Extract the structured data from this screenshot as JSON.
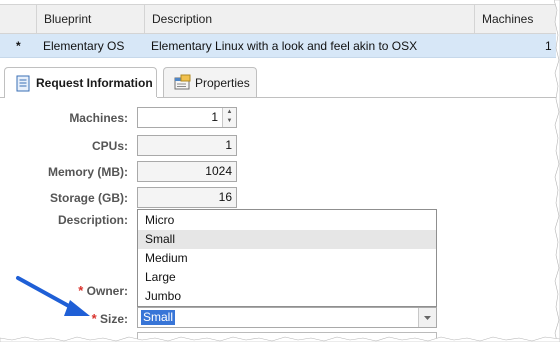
{
  "table": {
    "columns": [
      "Blueprint",
      "Description",
      "Machines"
    ],
    "row": {
      "required_marker": "*",
      "blueprint": "Elementary OS",
      "description": "Elementary Linux with a look and feel akin to OSX",
      "machines": "1"
    }
  },
  "tabs": [
    {
      "label": "Request Information",
      "icon": "document-icon",
      "active": true
    },
    {
      "label": "Properties",
      "icon": "properties-icon",
      "active": false
    }
  ],
  "form": {
    "machines": {
      "label": "Machines:",
      "value": "1"
    },
    "cpus": {
      "label": "CPUs:",
      "value": "1"
    },
    "memory": {
      "label": "Memory (MB):",
      "value": "1024"
    },
    "storage": {
      "label": "Storage (GB):",
      "value": "16"
    },
    "description": {
      "label": "Description:"
    },
    "owner": {
      "label": "Owner:",
      "required_marker": "*"
    },
    "size": {
      "label": "Size:",
      "required_marker": "*",
      "value": "Small"
    }
  },
  "size_dropdown": {
    "options": [
      "Micro",
      "Small",
      "Medium",
      "Large",
      "Jumbo"
    ],
    "highlighted": "Small"
  },
  "colors": {
    "selected_row": "#d7e7f7",
    "required": "#d9312b",
    "selection": "#3875d7",
    "annotation_arrow": "#1f5fd6"
  }
}
